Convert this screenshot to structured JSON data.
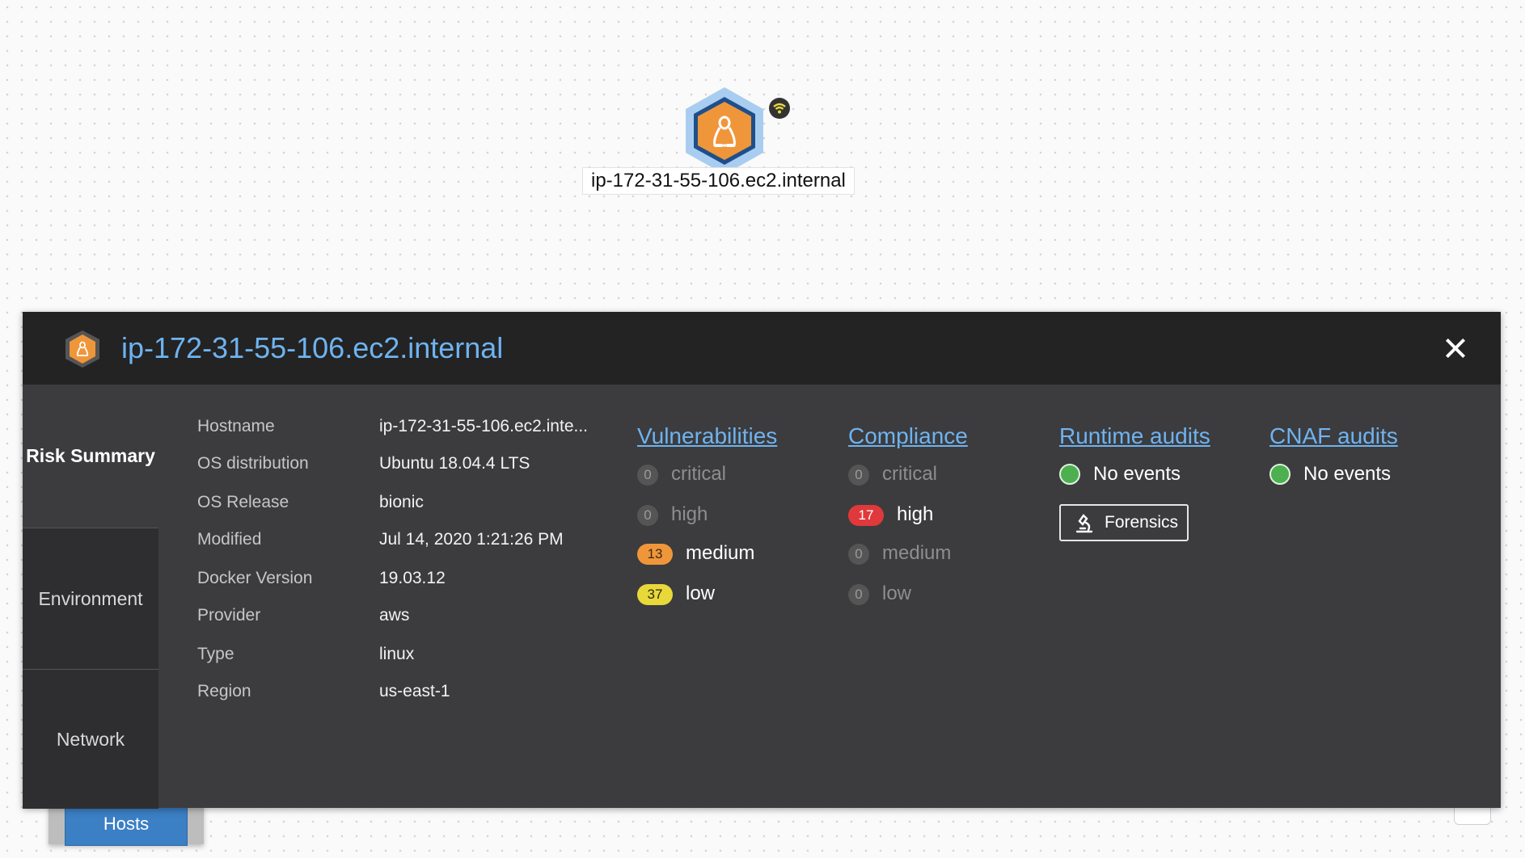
{
  "canvas": {
    "node_label": "ip-172-31-55-106.ec2.internal",
    "node_icon": "linux-host-hexagon-icon",
    "status_icon": "wifi-connected-icon",
    "bottom_tab": "Hosts"
  },
  "panel": {
    "title": "ip-172-31-55-106.ec2.internal",
    "close_icon": "close-icon",
    "nav": [
      {
        "label": "Risk Summary",
        "active": true
      },
      {
        "label": "Environment",
        "active": false
      },
      {
        "label": "Network",
        "active": false
      }
    ],
    "info": [
      {
        "key": "Hostname",
        "value": "ip-172-31-55-106.ec2.inte..."
      },
      {
        "key": "OS distribution",
        "value": "Ubuntu 18.04.4 LTS"
      },
      {
        "key": "OS Release",
        "value": "bionic"
      },
      {
        "key": "Modified",
        "value": "Jul 14, 2020 1:21:26 PM"
      },
      {
        "key": "Docker Version",
        "value": "19.03.12"
      },
      {
        "key": "Provider",
        "value": "aws"
      },
      {
        "key": "Type",
        "value": "linux"
      },
      {
        "key": "Region",
        "value": "us-east-1"
      }
    ],
    "vulnerabilities": {
      "title": "Vulnerabilities",
      "rows": [
        {
          "count": "0",
          "label": "critical"
        },
        {
          "count": "0",
          "label": "high"
        },
        {
          "count": "13",
          "label": "medium"
        },
        {
          "count": "37",
          "label": "low"
        }
      ]
    },
    "compliance": {
      "title": "Compliance",
      "rows": [
        {
          "count": "0",
          "label": "critical"
        },
        {
          "count": "17",
          "label": "high"
        },
        {
          "count": "0",
          "label": "medium"
        },
        {
          "count": "0",
          "label": "low"
        }
      ]
    },
    "runtime": {
      "title": "Runtime audits",
      "status": "No events",
      "button": "Forensics"
    },
    "cnaf": {
      "title": "CNAF audits",
      "status": "No events"
    }
  },
  "colors": {
    "accent": "#6fb3f0",
    "critical_red": "#e0393b",
    "medium_orange": "#f0963a",
    "low_yellow": "#e8d83a",
    "ok_green": "#4caf50"
  }
}
